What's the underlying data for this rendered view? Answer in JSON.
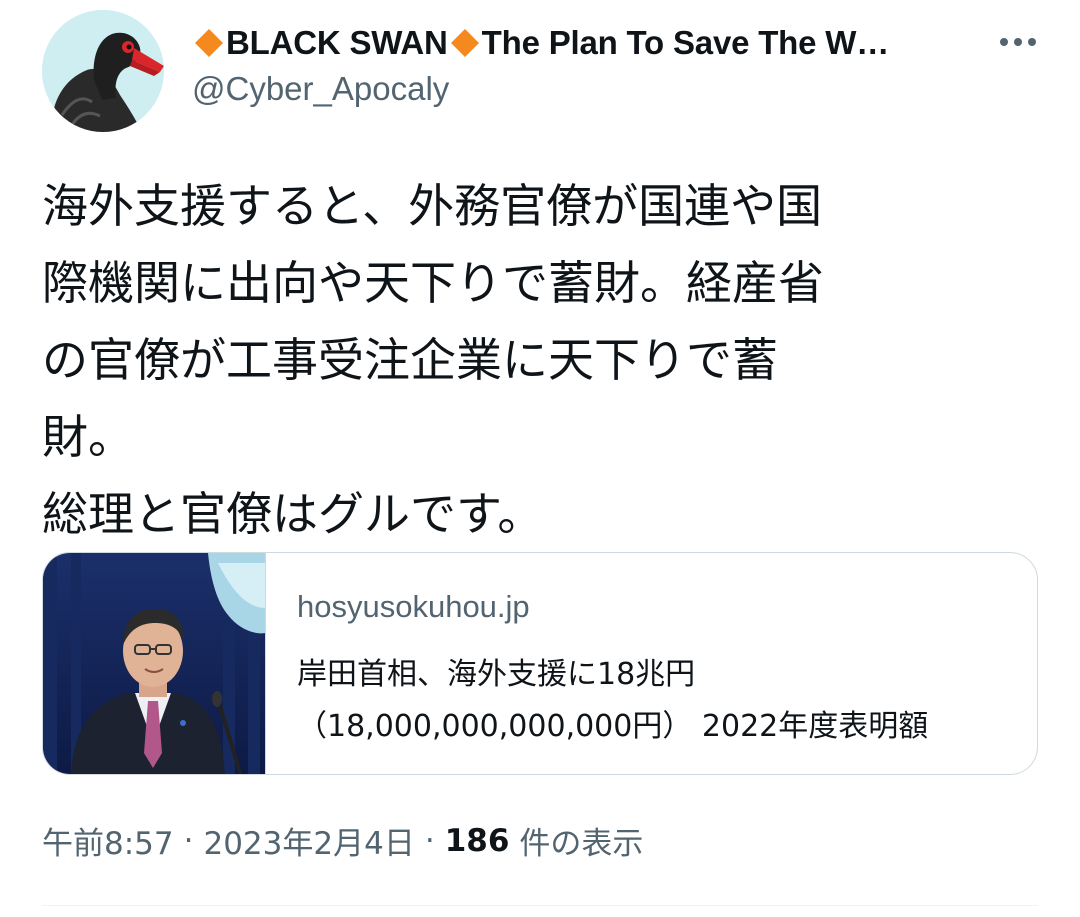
{
  "tweet": {
    "author": {
      "name_part1": "BLACK SWAN",
      "name_part2": "The Plan To Save The W…",
      "handle": "@Cyber_Apocaly",
      "diamond_color": "#f5891e"
    },
    "more_icon": "more-horizontal-icon",
    "text_lines": [
      "海外支援すると、外務官僚が国連や国",
      "際機関に出向や天下りで蓄財。経産省",
      "の官僚が工事受注企業に天下りで蓄",
      "財。",
      "総理と官僚はグルです。"
    ],
    "card": {
      "domain": "hosyusokuhou.jp",
      "title_line1": "岸田首相、海外支援に18兆円",
      "title_line2": "（18,000,000,000,000円） 2022年度表明額"
    },
    "meta": {
      "time": "午前8:57",
      "separator": "·",
      "date": "2023年2月4日",
      "views_count": "186",
      "views_label": "件の表示"
    }
  },
  "colors": {
    "text_primary": "#0f1419",
    "text_secondary": "#536471",
    "border": "#cfd9de",
    "avatar_bg": "#cfeef2"
  }
}
